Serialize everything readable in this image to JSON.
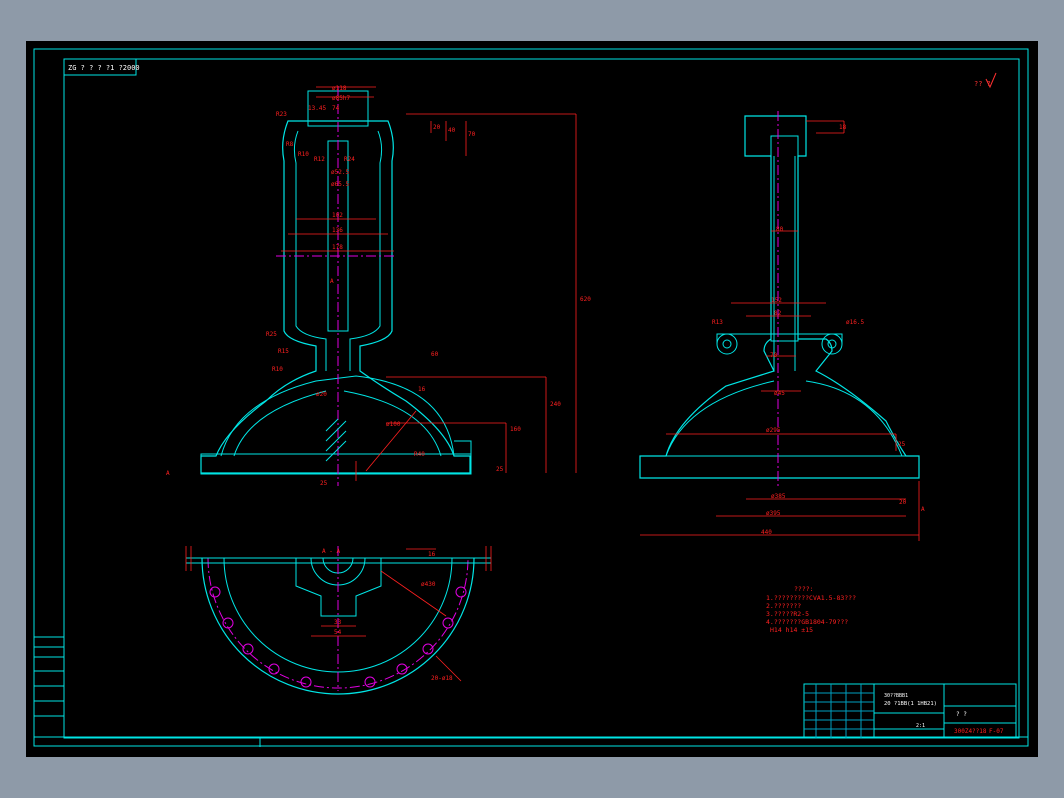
{
  "title_block": {
    "drawing_no": "300Z4??18",
    "sheet": "F-07",
    "scale": "2:1",
    "material_line1": "30??BBB1",
    "material_line2": "20 ?1BB(1 1HB21)",
    "qmarks": "?    ?"
  },
  "top_left_tag": "ZG ? ? ? ?1 ?2000",
  "roughness_note": "?? ?",
  "notes": {
    "heading": "????:",
    "items": [
      "1.?????????CVA1.5-83???",
      "2.???????",
      "3.?????R2-5",
      "4.???????GB1804-79???",
      "  H14 h14 ±15"
    ]
  },
  "dims": {
    "front": [
      "ø118",
      "ø85h7",
      "13.45",
      "74",
      "R23",
      "R8",
      "R10",
      "R12",
      "R24",
      "ø52.5",
      "ø65.5",
      "102",
      "136",
      "178",
      "R25",
      "R15",
      "R10",
      "ø20",
      "ø100",
      "R40",
      "16",
      "620",
      "240",
      "160",
      "60",
      "25",
      "70",
      "40",
      "20",
      "25",
      "A",
      "A"
    ],
    "side": [
      "80",
      "152",
      "82",
      "70",
      "ø45",
      "ø295",
      "ø385",
      "ø395",
      "440",
      "20",
      "R13",
      "ø16.5",
      "18",
      "25",
      "A"
    ],
    "plan": [
      "A - A",
      "ø430",
      "16",
      "33",
      "54",
      "20-ø18"
    ]
  },
  "colors": {
    "outline": "#00e5e5",
    "dimension": "#ff2020",
    "center": "#e000e0",
    "text_white": "#ffffff",
    "background": "#000000"
  }
}
